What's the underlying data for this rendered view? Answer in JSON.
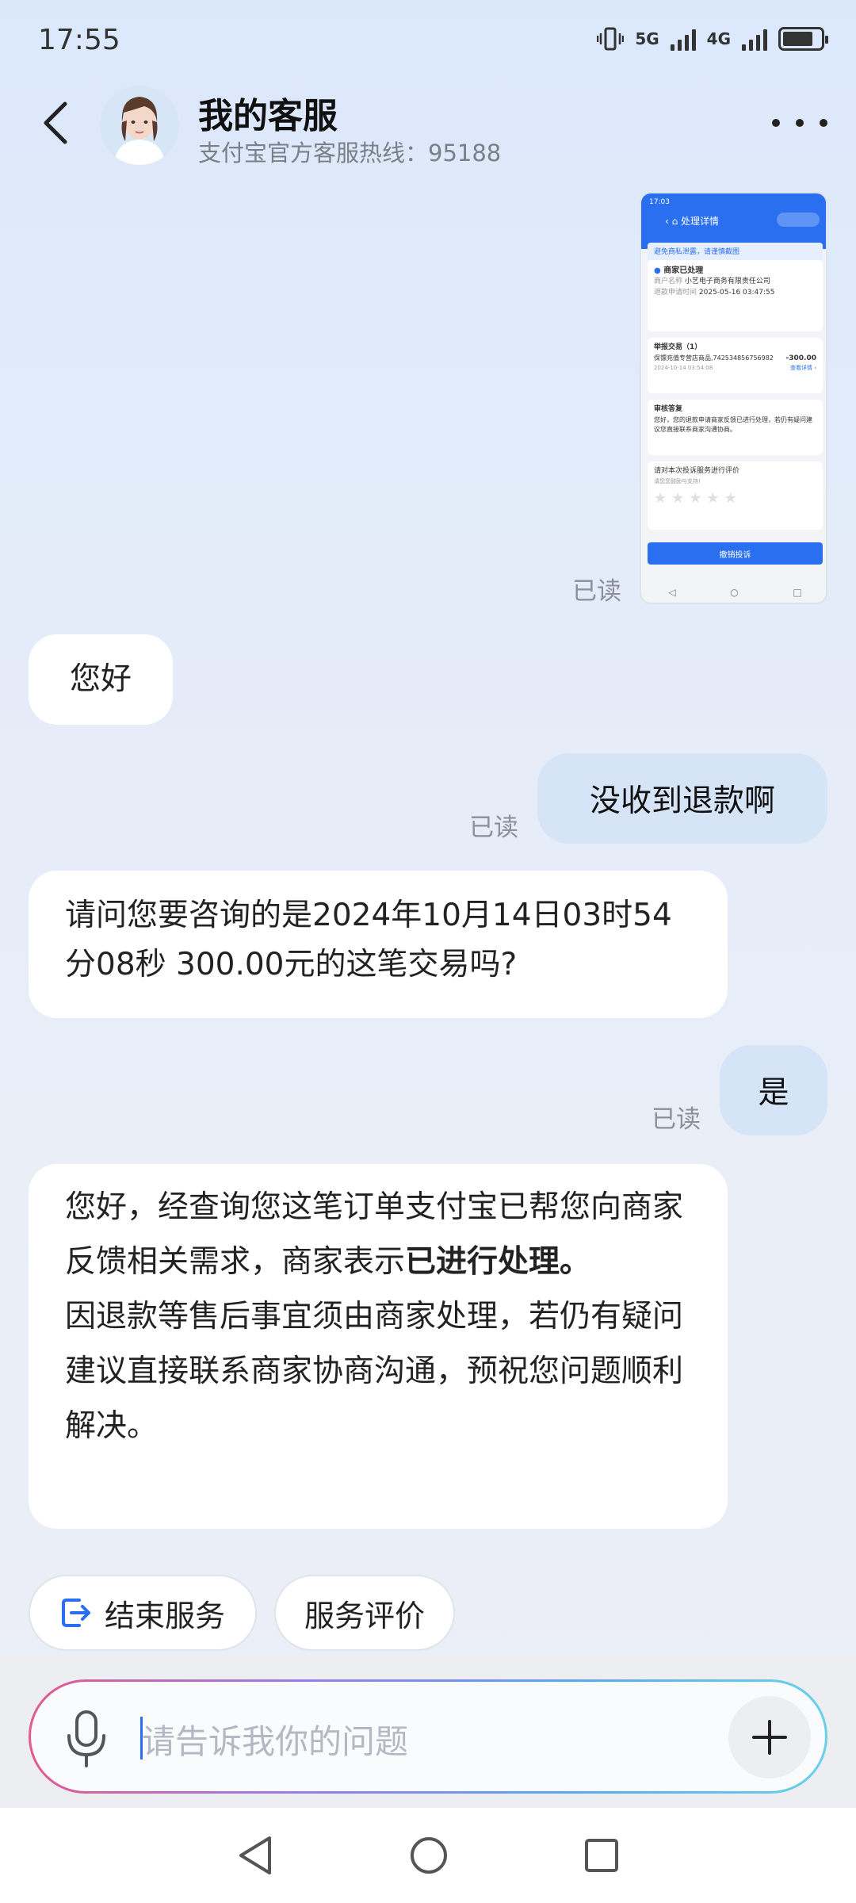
{
  "status_bar": {
    "time": "17:55",
    "signal1_label": "5G",
    "signal2_label": "4G"
  },
  "header": {
    "title": "我的客服",
    "subtitle": "支付宝官方客服热线：95188"
  },
  "screenshot_thumb": {
    "time": "17:03",
    "title": "处理详情",
    "notice": "避免商私泄露，请谨慎截图",
    "status": "商家已处理",
    "merchant_label": "商户名称",
    "merchant_value": "小艺电子商务有限责任公司",
    "date_label": "退款申请时间",
    "date_value": "2025-05-16 03:47:55",
    "report_title": "举报交易（1）",
    "report_item": "保镖充值专营店商品,742534856756982...",
    "report_amount": "-300.00",
    "report_date": "2024-10-14 03:54:08",
    "report_detail": "查看详情 ›",
    "review_title": "审核答复",
    "review_text": "您好，您的退款申请商家反馈已进行处理，若仍有疑问建议您直接联系商家沟通协商。",
    "rate_title": "请对本次投诉服务进行评价",
    "rate_sub": "请您您鼓励与支持!",
    "cancel_button": "撤销投诉"
  },
  "messages": {
    "read_label": "已读",
    "m1": "您好",
    "m2": "没收到退款啊",
    "m3": "请问您要咨询的是2024年10月14日03时54分08秒 300.00元的这笔交易吗?",
    "m4": "是",
    "m5_part1": "您好，经查询您这笔订单支付宝已帮您向商家反馈相关需求，商家表示",
    "m5_bold": "已进行处理。",
    "m5_part2": "因退款等售后事宜须由商家处理，若仍有疑问建议直接联系商家协商沟通，预祝您问题顺利解决。"
  },
  "actions": {
    "end_service": "结束服务",
    "rate_service": "服务评价"
  },
  "input": {
    "placeholder": "请告诉我你的问题"
  },
  "colors": {
    "accent": "#2a6ff0",
    "user_bubble": "#d6e4f8"
  }
}
